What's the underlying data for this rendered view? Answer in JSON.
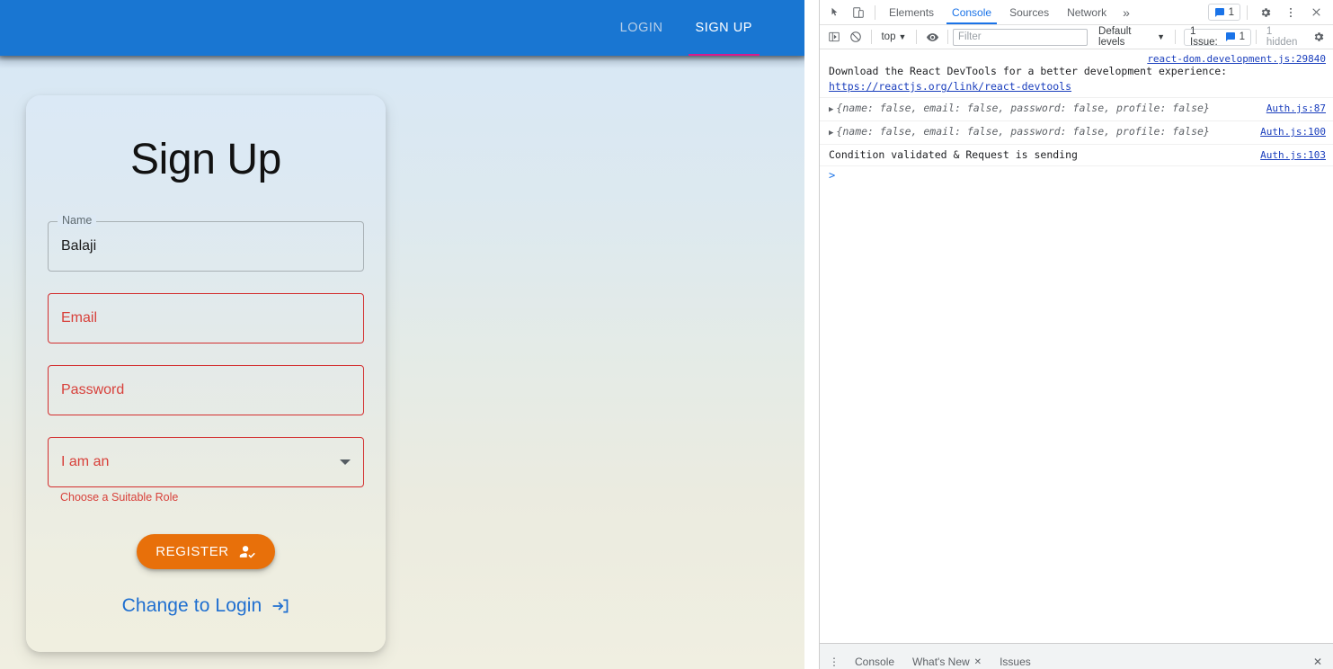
{
  "appbar": {
    "tabs": [
      {
        "label": "LOGIN",
        "active": false
      },
      {
        "label": "SIGN UP",
        "active": true
      }
    ],
    "bg_color": "#1976d2",
    "indicator_color": "#d81b8c"
  },
  "card": {
    "title": "Sign Up",
    "fields": [
      {
        "name": "name",
        "label": "Name",
        "value": "Balaji",
        "error": false,
        "helper": ""
      },
      {
        "name": "email",
        "label": "Email",
        "value": "",
        "error": true,
        "helper": ""
      },
      {
        "name": "password",
        "label": "Password",
        "value": "",
        "error": true,
        "helper": ""
      }
    ],
    "select": {
      "label": "I am an",
      "value": "",
      "error": true,
      "helper": "Choose a Suitable Role"
    },
    "register_button": {
      "label": "REGISTER",
      "icon": "how-to-reg-icon",
      "color": "#e8700a"
    },
    "change_link": {
      "label": "Change to Login",
      "icon": "login-arrow-icon",
      "color": "#1f6fd0"
    },
    "error_color": "#d32f2f"
  },
  "devtools": {
    "toolbar": {
      "inspect_icon": "inspect-element-icon",
      "device_icon": "device-toolbar-icon",
      "tabs": [
        {
          "label": "Elements",
          "active": false
        },
        {
          "label": "Console",
          "active": true
        },
        {
          "label": "Sources",
          "active": false
        },
        {
          "label": "Network",
          "active": false
        }
      ],
      "more_tabs": "»",
      "message_badge": "1",
      "settings_icon": "gear-icon",
      "kebab_icon": "more-vertical-icon",
      "close_icon": "close-icon"
    },
    "filterbar": {
      "sidebar_icon": "console-sidebar-icon",
      "clear_icon": "clear-console-icon",
      "context": "top",
      "eye_icon": "live-expression-icon",
      "filter_placeholder": "Filter",
      "filter_value": "",
      "levels": "Default levels",
      "issues_label": "1 Issue:",
      "issues_count": "1",
      "hidden_label": "1 hidden",
      "settings_icon": "gear-icon"
    },
    "messages": [
      {
        "kind": "text-link",
        "text_before": "Download the React DevTools for a better development experience: ",
        "link": "https://reactjs.org/link/react-devtools",
        "source": "react-dom.development.js:29840",
        "expandable": false
      },
      {
        "kind": "object",
        "object": "{name: false, email: false, password: false, profile: false}",
        "source": "Auth.js:87",
        "expandable": true
      },
      {
        "kind": "object",
        "object": "{name: false, email: false, password: false, profile: false}",
        "source": "Auth.js:100",
        "expandable": true
      },
      {
        "kind": "plain",
        "text": "Condition validated & Request is sending",
        "source": "Auth.js:103",
        "expandable": false
      }
    ],
    "prompt_symbol": ">",
    "drawer": {
      "kebab_icon": "more-vertical-icon",
      "tabs": [
        {
          "label": "Console",
          "closable": false
        },
        {
          "label": "What's New",
          "closable": true
        },
        {
          "label": "Issues",
          "closable": false
        }
      ],
      "close_icon": "close-drawer-icon"
    }
  }
}
